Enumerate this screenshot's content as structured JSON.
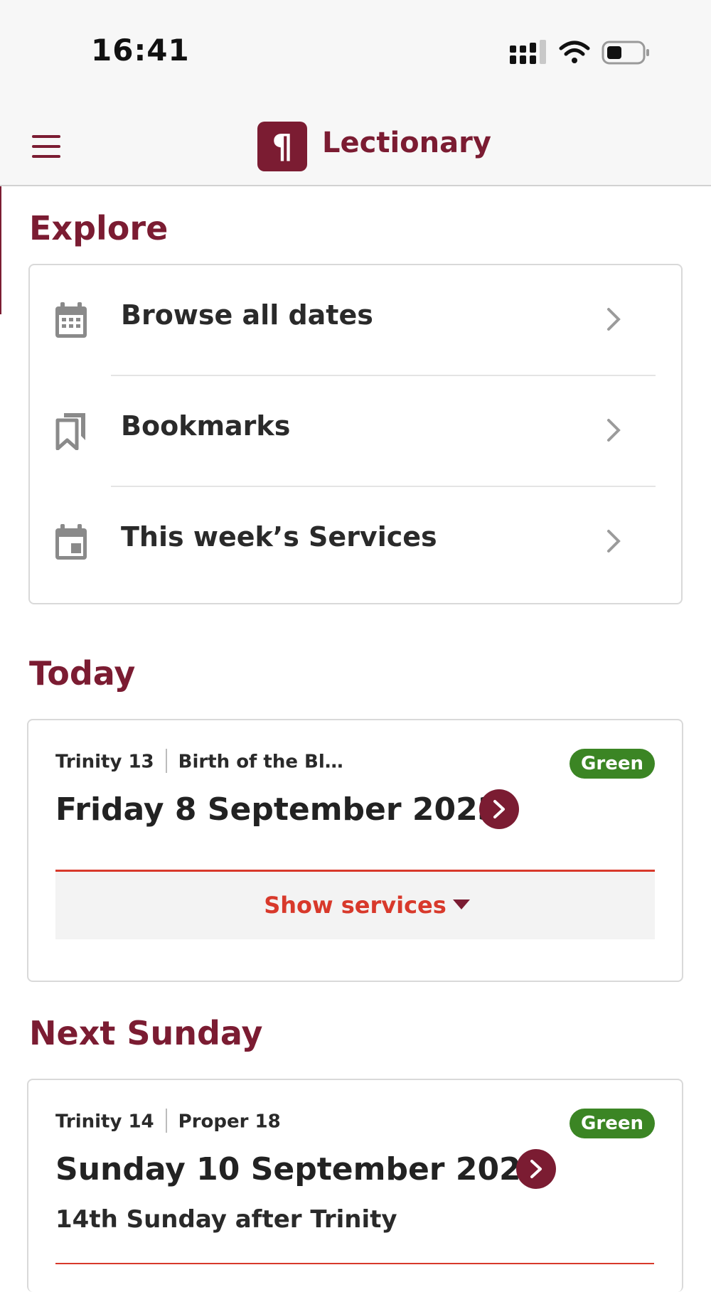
{
  "status_bar": {
    "time": "16:41"
  },
  "nav": {
    "title": "Lectionary",
    "logo_glyph": "¶"
  },
  "explore": {
    "title": "Explore",
    "items": [
      {
        "label": "Browse all dates",
        "icon": "calendar-grid-icon"
      },
      {
        "label": "Bookmarks",
        "icon": "bookmarks-icon"
      },
      {
        "label": "This week’s Services",
        "icon": "calendar-week-icon"
      }
    ]
  },
  "today": {
    "title": "Today",
    "season": "Trinity 13",
    "observance": "Birth of the Bl…",
    "colour_label": "Green",
    "colour": "#3b8524",
    "date": "Friday 8 September 2023",
    "show_services": "Show services"
  },
  "next_sunday": {
    "title": "Next Sunday",
    "season": "Trinity 14",
    "observance": "Proper 18",
    "colour_label": "Green",
    "colour": "#3b8524",
    "date": "Sunday 10 September 2023",
    "subtitle": "14th Sunday after Trinity"
  },
  "theme": {
    "brand": "#7b1c32",
    "accent_red": "#d8392b"
  }
}
